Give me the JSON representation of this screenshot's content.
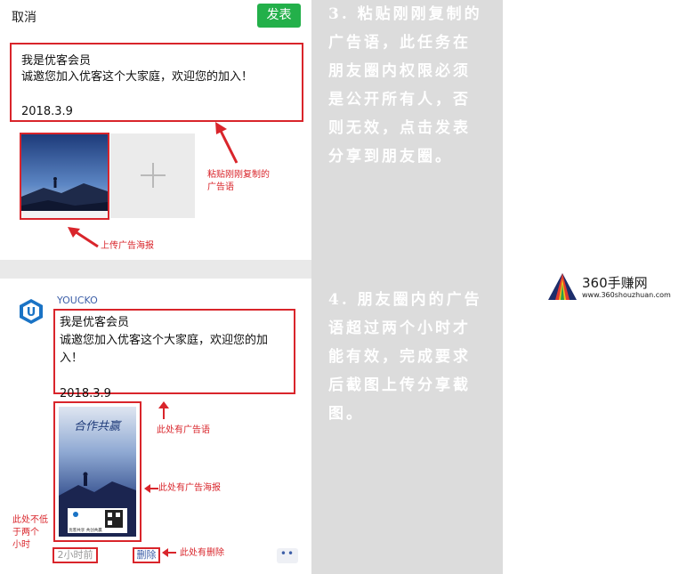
{
  "compose": {
    "cancel_label": "取消",
    "publish_label": "发表",
    "text_line1": "我是优客会员",
    "text_line2": "诚邀您加入优客这个大家庭，欢迎您的加入！",
    "date": "2018.3.9",
    "anno_paste_line1": "粘贴刚刚复制的",
    "anno_paste_line2": "广告语",
    "anno_upload": "上传广告海报"
  },
  "moment": {
    "username": "YOUCKO",
    "avatar_letter": "U",
    "text_line1": "我是优客会员",
    "text_line2": "诚邀您加入优客这个大家庭，欢迎您的加",
    "text_line3": "入！",
    "date": "2018.3.9",
    "poster_title": "合作共赢",
    "poster_footer": "优客共享   共创共赢",
    "time_ago": "2小时前",
    "delete_label": "删除",
    "more_label": "••",
    "anno_slogan": "此处有广告语",
    "anno_poster": "此处有广告海报",
    "anno_time_line1": "此处不低",
    "anno_time_line2": "于两个",
    "anno_time_line3": "小时",
    "anno_delete": "此处有删除"
  },
  "instructions": {
    "step3": [
      "3. 粘贴刚刚复制的",
      "广告语，此任务在",
      "朋友圈内权限必须",
      "是公开所有人，否",
      "则无效，点击发表",
      "分享到朋友圈。"
    ],
    "step4": [
      "4. 朋友圈内的广告",
      "语超过两个小时才",
      "能有效，完成要求",
      "后截图上传分享截",
      "图。"
    ]
  },
  "logo": {
    "name": "360手赚网",
    "url": "www.360shouzhuan.com"
  },
  "colors": {
    "accent_red": "#d9252b",
    "publish_green": "#23b04a",
    "link_blue": "#3d5fa8"
  }
}
